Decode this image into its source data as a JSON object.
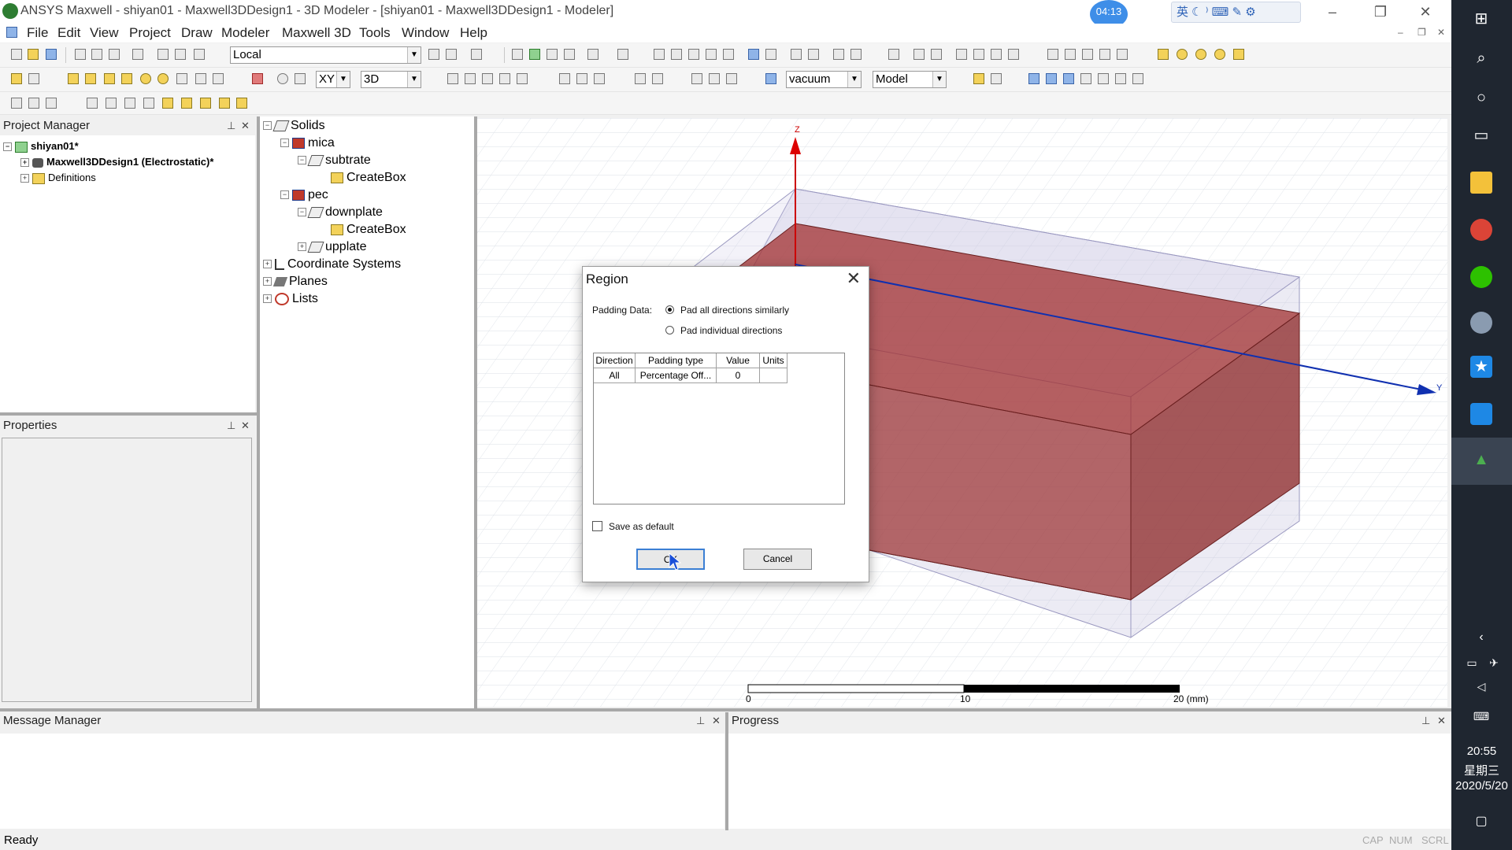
{
  "window": {
    "title": "ANSYS Maxwell - shiyan01 - Maxwell3DDesign1 - 3D Modeler - [shiyan01 - Maxwell3DDesign1 - Modeler]",
    "clock_badge": "04:13",
    "ime_label": "英"
  },
  "menu": [
    "File",
    "Edit",
    "View",
    "Project",
    "Draw",
    "Modeler",
    "Maxwell 3D",
    "Tools",
    "Window",
    "Help"
  ],
  "toolbar": {
    "coord_system": "Local",
    "plane": "XY",
    "mode": "3D",
    "material": "vacuum",
    "model": "Model"
  },
  "project_manager": {
    "header": "Project Manager",
    "project": "shiyan01*",
    "design": "Maxwell3DDesign1 (Electrostatic)*",
    "definitions": "Definitions"
  },
  "properties": {
    "header": "Properties"
  },
  "model_tree": {
    "solids": "Solids",
    "mica": "mica",
    "subtrate": "subtrate",
    "createbox1": "CreateBox",
    "pec": "pec",
    "downplate": "downplate",
    "createbox2": "CreateBox",
    "upplate": "upplate",
    "coordinate_systems": "Coordinate Systems",
    "planes": "Planes",
    "lists": "Lists"
  },
  "viewport": {
    "axis_z": "Z",
    "axis_y": "Y",
    "scale_labels": [
      "0",
      "10",
      "20 (mm)"
    ]
  },
  "dialog": {
    "title": "Region",
    "padding_label": "Padding Data:",
    "option_all": "Pad all directions similarly",
    "option_individual": "Pad individual directions",
    "selected_option": "Pad all directions similarly",
    "columns": [
      "Direction",
      "Padding type",
      "Value",
      "Units"
    ],
    "rows": [
      {
        "direction": "All",
        "padding_type": "Percentage Off...",
        "value": "0",
        "units": ""
      }
    ],
    "save_default_label": "Save as default",
    "save_default_checked": false,
    "ok_label": "OK",
    "cancel_label": "Cancel"
  },
  "message_manager": {
    "header": "Message Manager"
  },
  "progress": {
    "header": "Progress"
  },
  "status": {
    "text": "Ready",
    "indicators": [
      "CAP",
      "NUM",
      "SCRL"
    ]
  },
  "taskbar": {
    "time": "20:55",
    "weekday": "星期三",
    "date": "2020/5/20"
  }
}
